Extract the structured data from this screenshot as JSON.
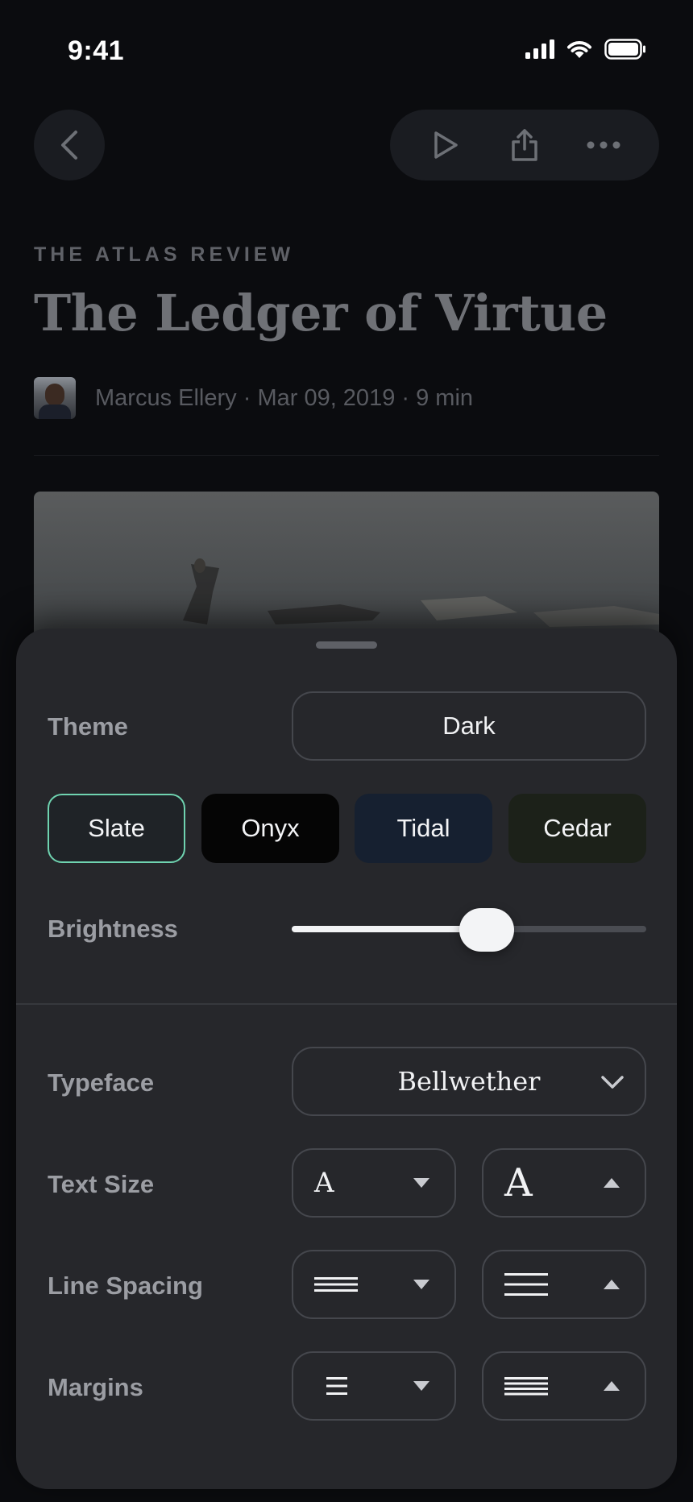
{
  "status_bar": {
    "time": "9:41"
  },
  "nav": {
    "back_icon": "chevron-left-icon",
    "actions": [
      "play-icon",
      "share-icon",
      "more-icon"
    ]
  },
  "article": {
    "publication": "THE ATLAS REVIEW",
    "title": "The Ledger of Virtue",
    "author": "Marcus Ellery",
    "date": "Mar 09, 2019",
    "read_time": "9 min",
    "meta_separator": " · "
  },
  "settings": {
    "theme": {
      "label": "Theme",
      "value": "Dark"
    },
    "swatches": [
      {
        "label": "Slate",
        "bg": "#1f2327",
        "selected": true
      },
      {
        "label": "Onyx",
        "bg": "#050505",
        "selected": false
      },
      {
        "label": "Tidal",
        "bg": "#162030",
        "selected": false
      },
      {
        "label": "Cedar",
        "bg": "#1c2119",
        "selected": false
      }
    ],
    "accent": "#6fd3b0",
    "brightness": {
      "label": "Brightness",
      "value": 0.55
    },
    "typeface": {
      "label": "Typeface",
      "value": "Bellwether"
    },
    "text_size": {
      "label": "Text Size",
      "decrease_glyph": "A",
      "increase_glyph": "A"
    },
    "line_spacing": {
      "label": "Line Spacing"
    },
    "margins": {
      "label": "Margins"
    }
  }
}
